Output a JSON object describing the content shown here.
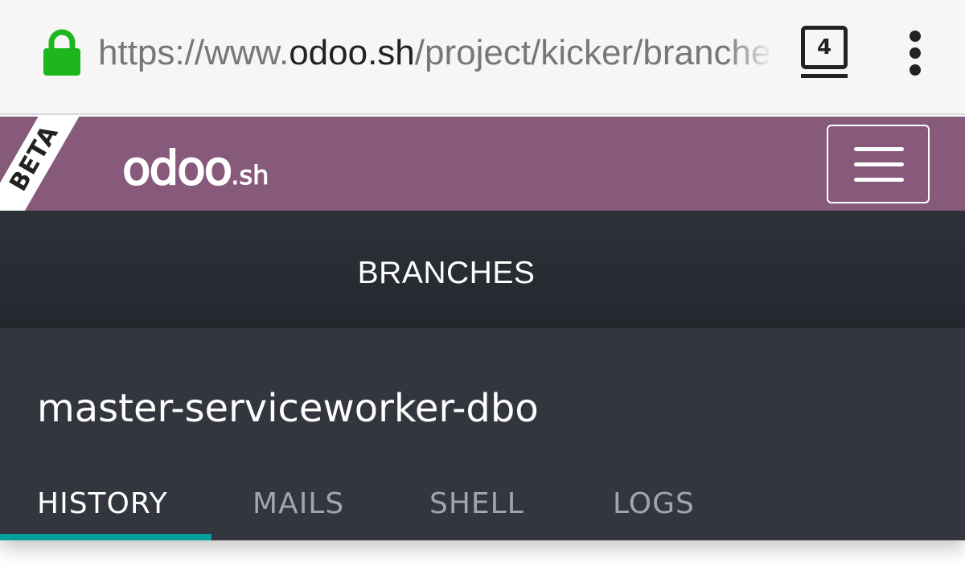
{
  "browser": {
    "url_scheme": "https://www.",
    "url_host": "odoo.sh",
    "url_path": "/project/kicker/branches",
    "tab_count": "4",
    "icons": [
      "lock-icon",
      "tab-switcher-icon",
      "more-vert-icon"
    ]
  },
  "header": {
    "ribbon": "BETA",
    "logo_main": "odoo",
    "logo_suffix": ".sh",
    "menu_icon": "hamburger-icon",
    "bg_color": "#875a7b"
  },
  "nav": {
    "section_label": "BRANCHES"
  },
  "branch": {
    "name": "master-serviceworker-dbo",
    "tabs": [
      {
        "label": "HISTORY",
        "active": true
      },
      {
        "label": "MAILS",
        "active": false
      },
      {
        "label": "SHELL",
        "active": false
      },
      {
        "label": "LOGS",
        "active": false
      }
    ],
    "accent_color": "#00a09d"
  }
}
